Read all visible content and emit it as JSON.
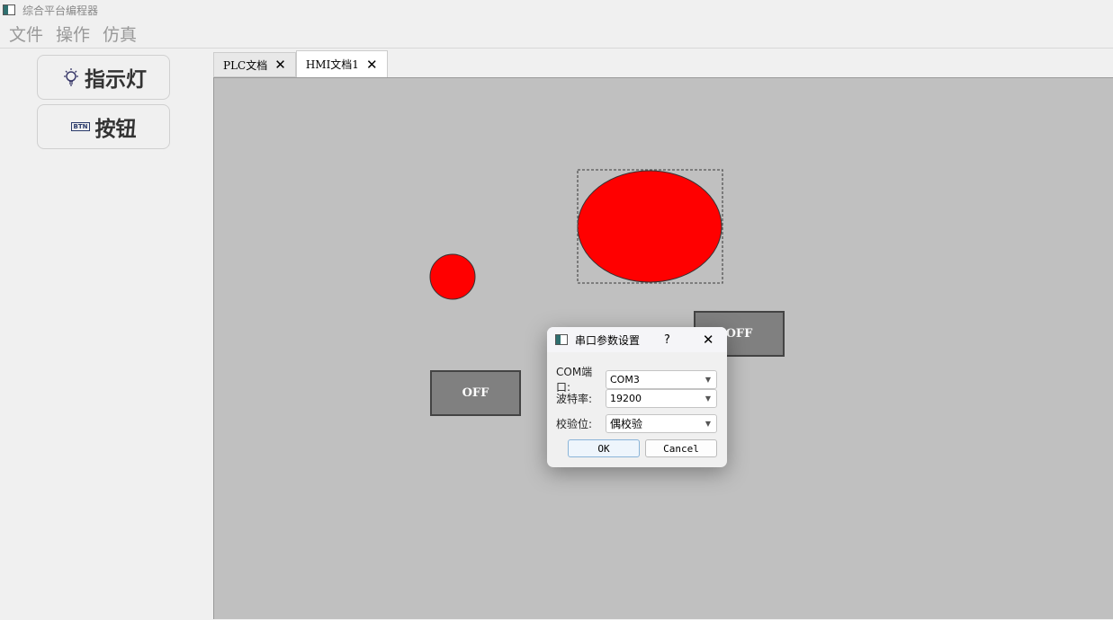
{
  "window": {
    "title": "综合平台编程器"
  },
  "menu": [
    "文件",
    "操作",
    "仿真"
  ],
  "toolbox": [
    {
      "label": "指示灯",
      "icon": "lightbulb-icon"
    },
    {
      "label": "按钮",
      "icon": "btn-icon",
      "icon_text": "BTN"
    }
  ],
  "tabs": [
    {
      "label": "PLC文档",
      "active": false
    },
    {
      "label": "HMI文档1",
      "active": true
    }
  ],
  "canvas": {
    "background": "#c0c0c0",
    "lamp_color": "#ff0000",
    "buttons": [
      {
        "label": "OFF"
      },
      {
        "label": "OFF"
      }
    ]
  },
  "dialog": {
    "title": "串口参数设置",
    "help": "?",
    "close": "✕",
    "fields": [
      {
        "label": "COM端口:",
        "value": "COM3"
      },
      {
        "label": "波特率:",
        "value": "19200"
      },
      {
        "label": "校验位:",
        "value": "偶校验"
      }
    ],
    "ok": "OK",
    "cancel": "Cancel"
  }
}
